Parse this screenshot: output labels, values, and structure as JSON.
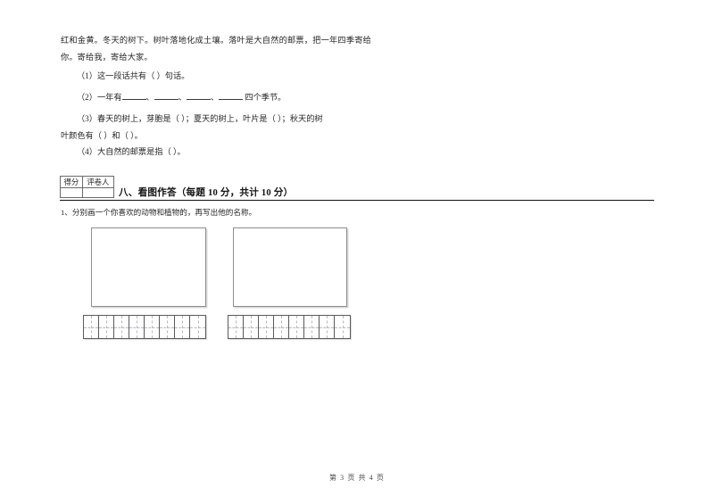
{
  "document": {
    "passage_text": "红和金黄。冬天的树下。树叶落地化成土壤。落叶是大自然的邮票，把一年四季寄给你。寄给我，寄给大家。",
    "questions": [
      {
        "number": "（1）",
        "text": "这一段话共有（    ）句话。"
      },
      {
        "number": "（2）",
        "text_before": "一年有",
        "text_after": "四个季节。",
        "blank_count": 4,
        "separators": [
          "、",
          "、",
          "、",
          ""
        ]
      },
      {
        "number": "（3）",
        "line1": "春天的树上，芽胞是（            ）；夏天的树上，叶片是（            ）；秋天的树",
        "line2": "叶颜色有（          ）和（          ）。"
      },
      {
        "number": "（4）",
        "text": "大自然的邮票是指（         ）。"
      }
    ],
    "score_box": {
      "score_label": "得分",
      "grader_label": "评卷人",
      "score_value": "",
      "grader_value": ""
    },
    "section": {
      "title": "八、看图作答（每题 10 分，共计 10 分）",
      "task_number": "1、",
      "task_text": "分别画一个你喜欢的动物和植物的，再写出他的名称。"
    },
    "drawing_areas": [
      {
        "name": "animal-drawing-area",
        "content": ""
      },
      {
        "name": "plant-drawing-area",
        "content": ""
      }
    ],
    "answer_grids": [
      {
        "name": "animal-name-grid",
        "cells": 8
      },
      {
        "name": "plant-name-grid",
        "cells": 8
      }
    ],
    "footer": {
      "text": "第 3 页 共 4 页",
      "current_page": "3",
      "total_pages": "4"
    }
  }
}
